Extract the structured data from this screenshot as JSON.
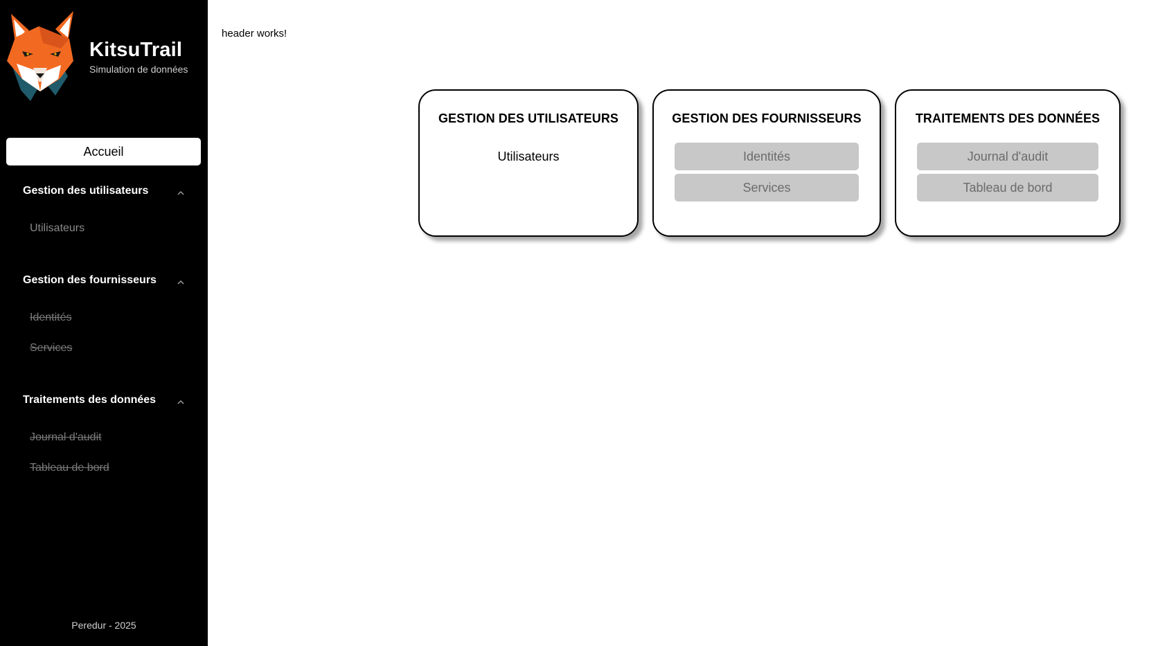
{
  "sidebar": {
    "brand": {
      "title": "KitsuTrail",
      "subtitle": "Simulation de données"
    },
    "home_label": "Accueil",
    "sections": [
      {
        "title": "Gestion des utilisateurs",
        "items": [
          "Utilisateurs"
        ]
      },
      {
        "title": "Gestion des fournisseurs",
        "items": [
          "Identités",
          "Services"
        ]
      },
      {
        "title": "Traitements des données",
        "items": [
          "Journal d'audit",
          "Tableau de bord"
        ]
      }
    ],
    "footer": "Peredur - 2025"
  },
  "main": {
    "header_text": "header works!",
    "cards": [
      {
        "title": "GESTION DES UTILISATEURS",
        "items": [
          "Utilisateurs"
        ]
      },
      {
        "title": "GESTION DES FOURNISSEURS",
        "items": [
          "Identités",
          "Services"
        ]
      },
      {
        "title": "TRAITEMENTS DES DONNÉES",
        "items": [
          "Journal d'audit",
          "Tableau de bord"
        ]
      }
    ]
  },
  "colors": {
    "sidebar_bg": "#000000",
    "disabled_button_bg": "#c8c8c8",
    "disabled_text": "#6b6b6b",
    "fox_orange": "#f26a21",
    "fox_teal": "#1f5b6b"
  },
  "icons": [
    "fox-logo-icon",
    "chevron-up-icon"
  ]
}
